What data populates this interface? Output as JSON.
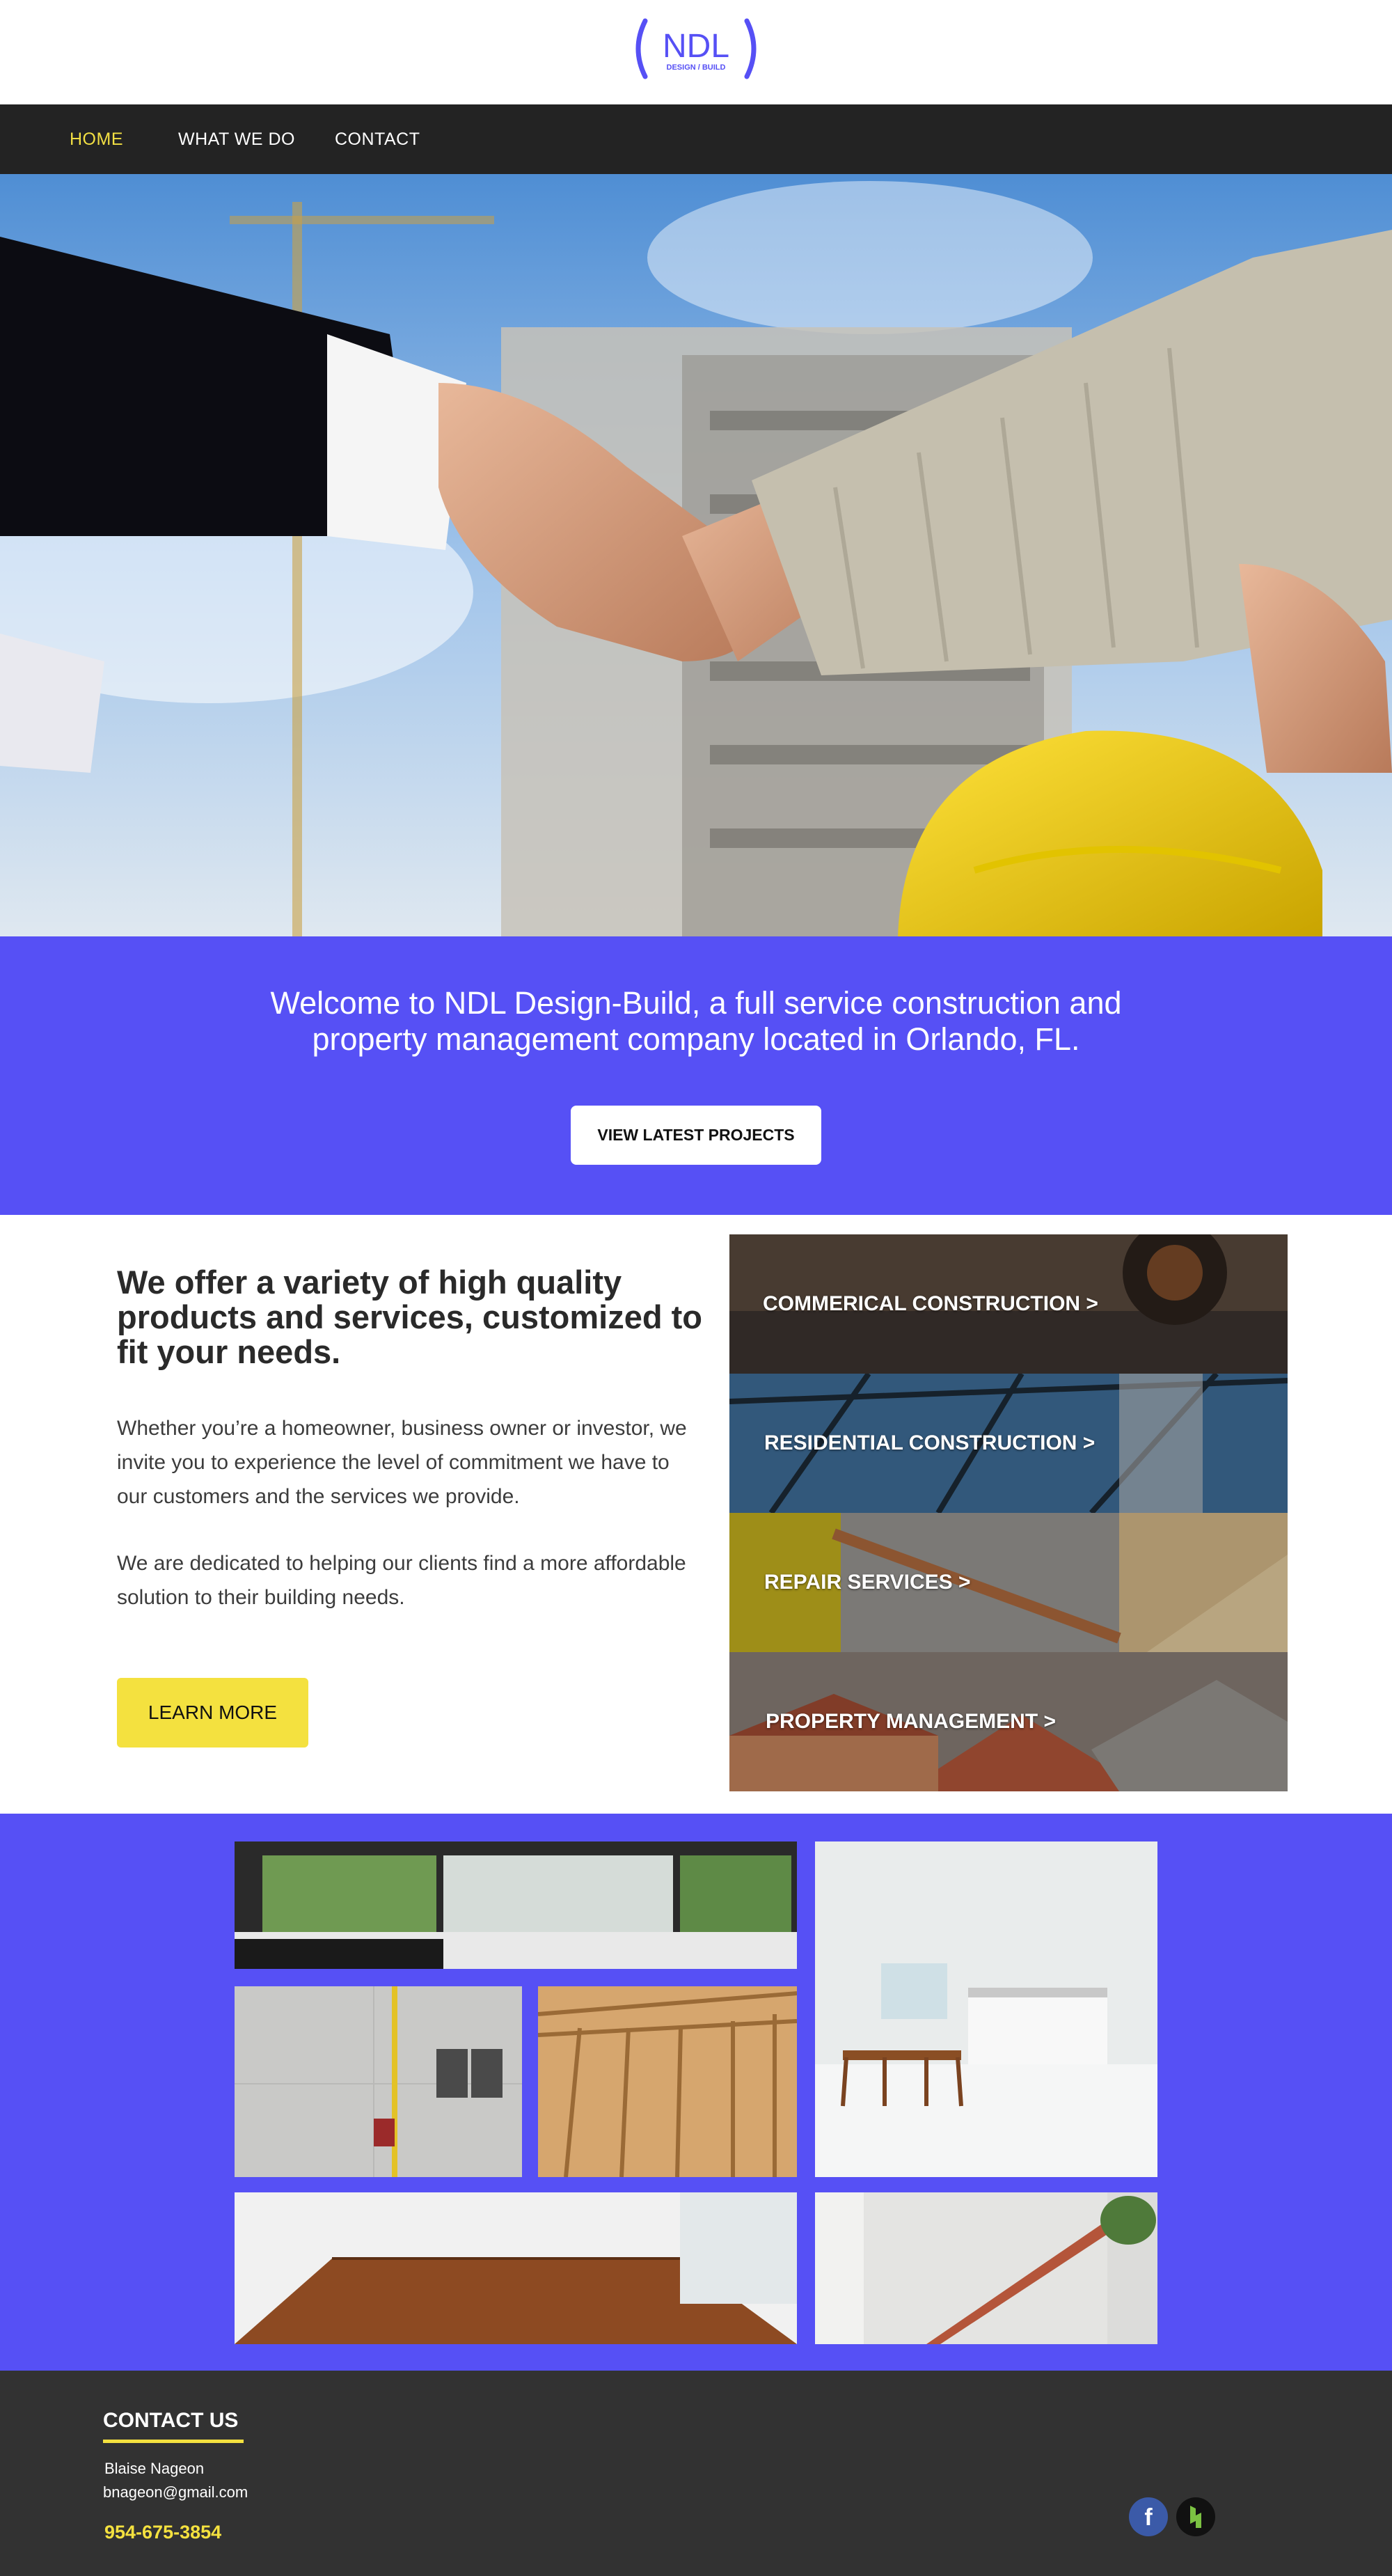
{
  "brand": {
    "logo_text": "NDL",
    "logo_subtext": "DESIGN / BUILD",
    "accent": "#5650f5",
    "yellow": "#f4e13f",
    "dark": "#232323"
  },
  "nav": {
    "items": [
      {
        "label": "HOME",
        "active": true
      },
      {
        "label": "WHAT WE DO",
        "active": false
      },
      {
        "label": "CONTACT",
        "active": false
      }
    ]
  },
  "hero": {
    "image": "handshake-construction-photo"
  },
  "welcome": {
    "text": "Welcome to NDL Design-Build, a full service construction and property management company located in Orlando, FL.",
    "button_label": "VIEW LATEST PROJECTS"
  },
  "services": {
    "heading": "We offer a variety of high quality products and services, customized to fit your needs.",
    "paragraph_1": "Whether you’re a homeowner, business owner or investor, we invite you to experience the level of commitment we have to our customers and the services we provide.",
    "paragraph_2": "We are dedicated to helping our clients find a more affordable solution to their building needs.",
    "learn_more_label": "LEARN MORE",
    "tiles": [
      {
        "label": "COMMERICAL CONSTRUCTION   >"
      },
      {
        "label": "RESIDENTIAL CONSTRUCTION   >"
      },
      {
        "label": "REPAIR SERVICES   >"
      },
      {
        "label": "PROPERTY MANAGEMENT   >"
      }
    ]
  },
  "gallery": {
    "images": [
      "modern-kitchen-photo",
      "white-dining-room-photo",
      "utility-meters-photo",
      "wood-framing-photo",
      "parquet-floor-room-photo",
      "staircase-interior-photo"
    ]
  },
  "footer": {
    "title": "CONTACT US",
    "name": "Blaise Nageon",
    "email": "bnageon@gmail.com",
    "phone": "954-675-3854",
    "social": [
      "facebook-icon",
      "houzz-icon"
    ]
  }
}
